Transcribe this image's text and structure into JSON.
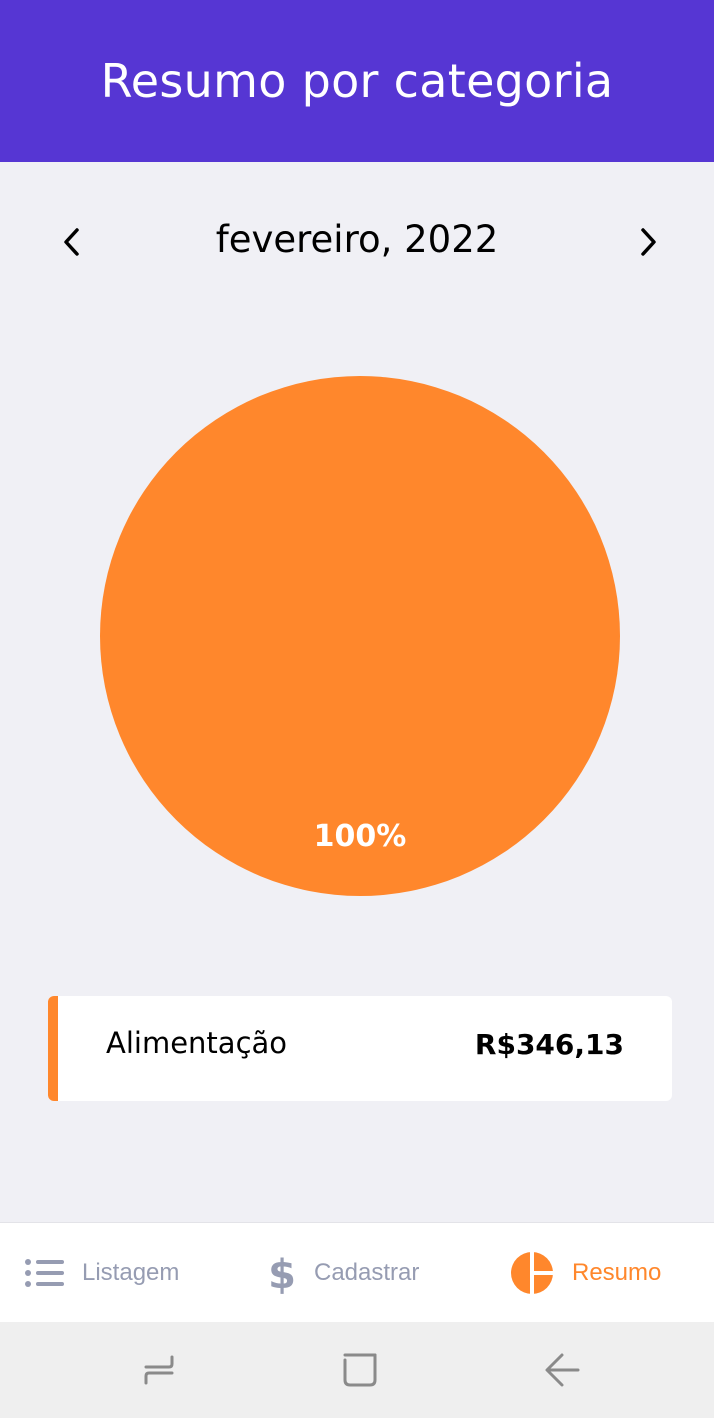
{
  "header": {
    "title": "Resumo por categoria"
  },
  "month_selector": {
    "label": "fevereiro, 2022",
    "prev_icon": "chevron-left-icon",
    "next_icon": "chevron-right-icon"
  },
  "colors": {
    "header": "#5636D3",
    "background": "#F0F0F5",
    "accent": "#FF872C",
    "tab_inactive": "#969CB2",
    "tab_active": "#FF872C"
  },
  "chart_data": {
    "type": "pie",
    "slices": [
      {
        "label": "Alimentação",
        "value": 346.13,
        "percent_label": "100%",
        "color": "#FF872C"
      }
    ]
  },
  "categories": [
    {
      "name": "Alimentação",
      "amount": "R$346,13",
      "color": "#FF872C"
    }
  ],
  "tabs": [
    {
      "label": "Listagem",
      "icon": "list-icon",
      "active": false
    },
    {
      "label": "Cadastrar",
      "icon": "dollar-sign-icon",
      "active": false
    },
    {
      "label": "Resumo",
      "icon": "pie-chart-icon",
      "active": true
    }
  ],
  "system_nav": {
    "buttons": [
      "recent-apps-icon",
      "home-icon",
      "back-icon"
    ]
  }
}
